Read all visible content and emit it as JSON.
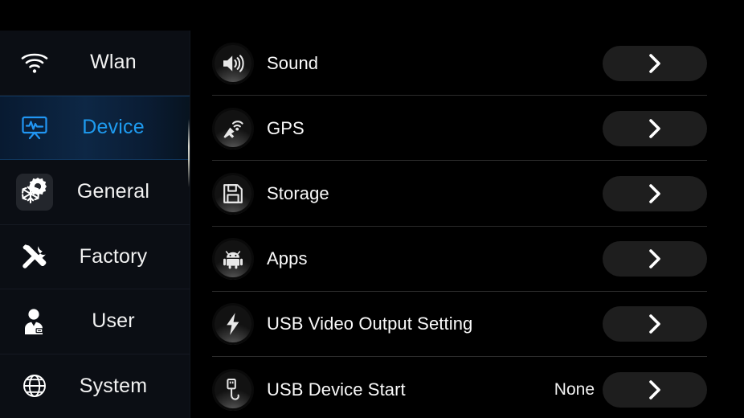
{
  "theme": {
    "background": "#000000",
    "sidebar_background": "#0b0e14",
    "accent": "#1e9bf0",
    "active_row_gradient_start": "#081a31",
    "active_row_gradient_end": "#07131f",
    "text_primary": "#fafafa",
    "divider": "#2b2b2b",
    "button_background": "#1e1e1e"
  },
  "sidebar": {
    "items": [
      {
        "label": "Wlan",
        "icon": "wifi-icon",
        "active": false
      },
      {
        "label": "Device",
        "icon": "display-waveform-icon",
        "active": true
      },
      {
        "label": "General",
        "icon": "gear-snowflake-icon",
        "active": false
      },
      {
        "label": "Factory",
        "icon": "tools-icon",
        "active": false
      },
      {
        "label": "User",
        "icon": "user-icon",
        "active": false
      },
      {
        "label": "System",
        "icon": "globe-icon",
        "active": false
      }
    ],
    "scrollbar": {
      "visible": true
    }
  },
  "main": {
    "rows": [
      {
        "label": "Sound",
        "icon": "speaker-icon",
        "value": "",
        "chevron": "chevron-right-icon"
      },
      {
        "label": "GPS",
        "icon": "satellite-icon",
        "value": "",
        "chevron": "chevron-right-icon"
      },
      {
        "label": "Storage",
        "icon": "floppy-disk-icon",
        "value": "",
        "chevron": "chevron-right-icon"
      },
      {
        "label": "Apps",
        "icon": "android-icon",
        "value": "",
        "chevron": "chevron-right-icon"
      },
      {
        "label": "USB Video Output Setting",
        "icon": "lightning-bolt-icon",
        "value": "",
        "chevron": "chevron-right-icon"
      },
      {
        "label": "USB Device Start",
        "icon": "usb-icon",
        "value": "None",
        "chevron": "chevron-right-icon"
      }
    ]
  }
}
